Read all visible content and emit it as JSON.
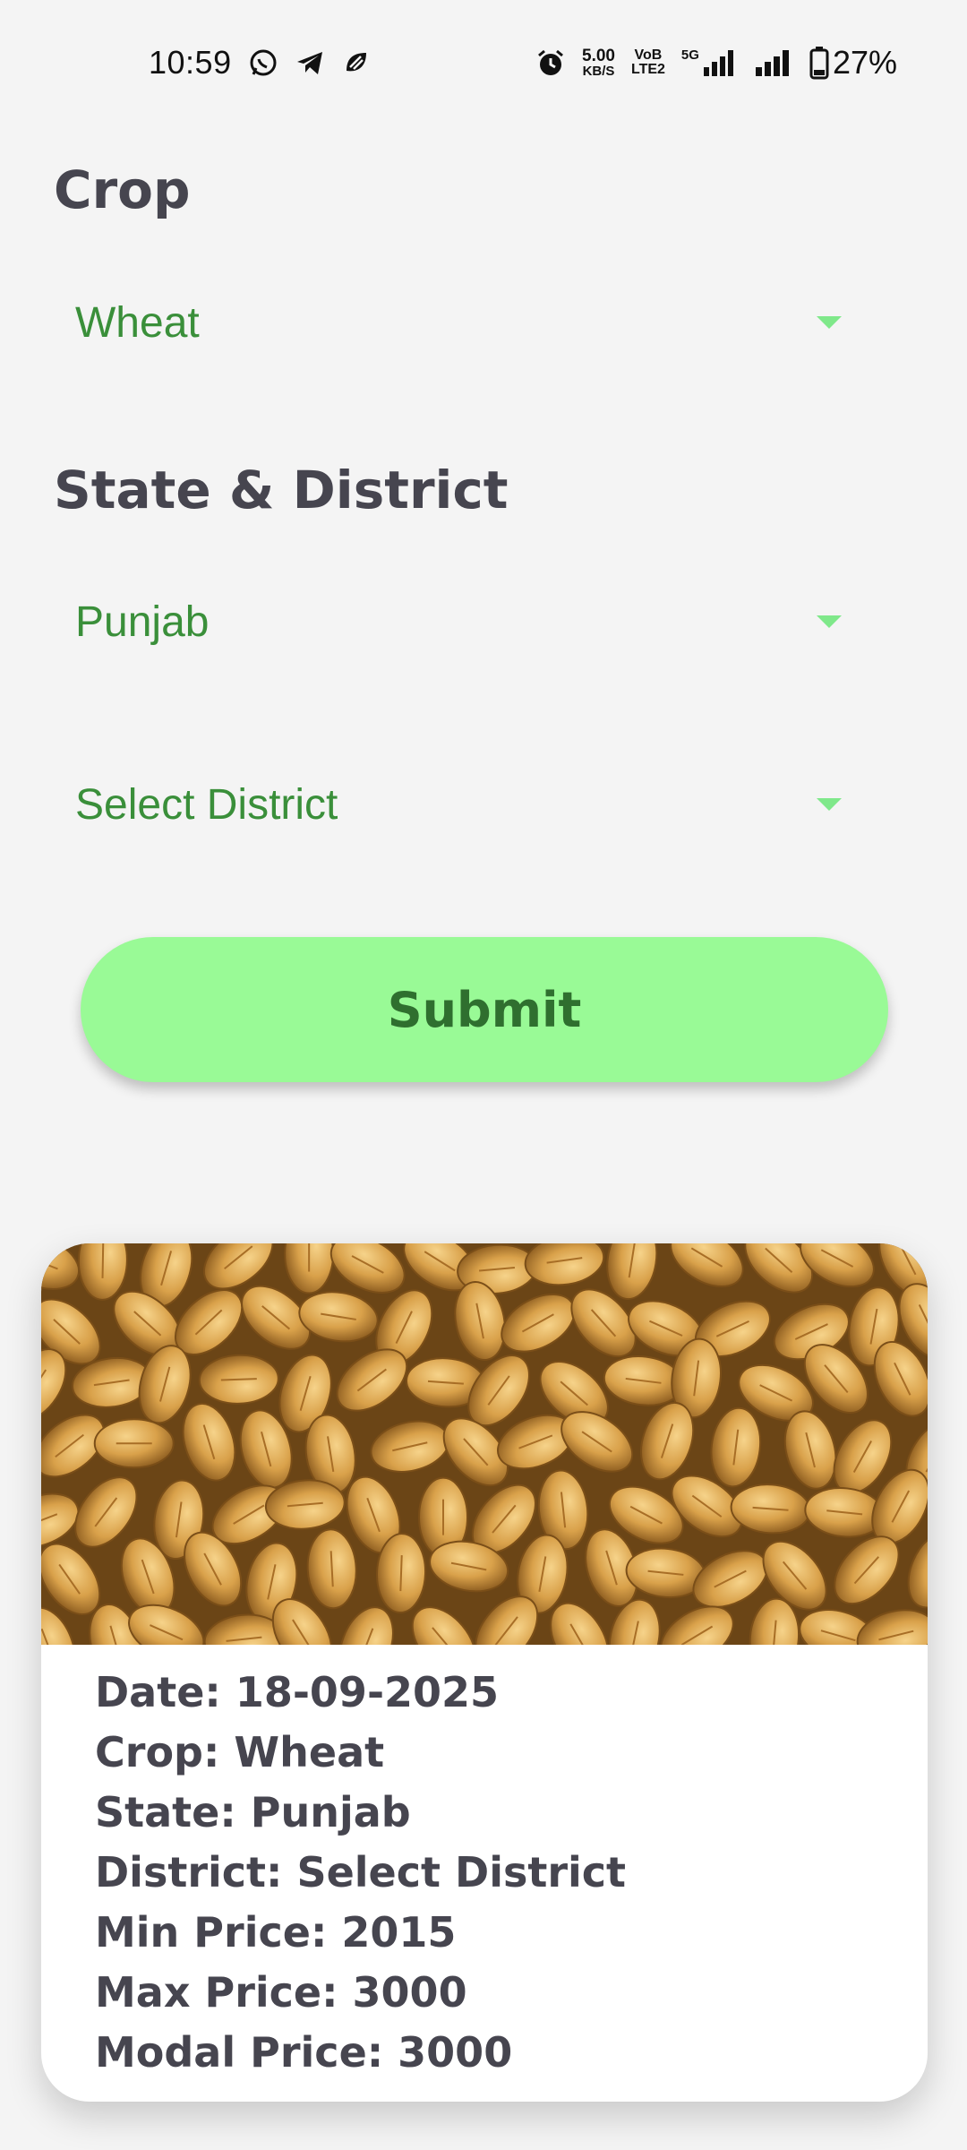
{
  "status_bar": {
    "time": "10:59",
    "speed_value": "5.00",
    "speed_unit": "KB/S",
    "volte_top": "VoB",
    "volte_bottom": "LTE2",
    "network": "5G",
    "battery": "27%",
    "icons": [
      "whatsapp-icon",
      "telegram-icon",
      "app-icon",
      "alarm-icon",
      "signal-icon",
      "signal-icon-2",
      "battery-icon"
    ]
  },
  "crop": {
    "title": "Crop",
    "selected": "Wheat"
  },
  "location": {
    "title": "State & District",
    "state_selected": "Punjab",
    "district_selected": "Select District"
  },
  "submit_label": "Submit",
  "result": {
    "image_alt": "wheat grains",
    "lines": [
      "Date: 18-09-2025",
      "Crop: Wheat",
      "State: Punjab",
      "District: Select District",
      "Min Price: 2015",
      "Max Price: 3000",
      "Modal Price: 3000"
    ]
  },
  "colors": {
    "accent_green_text": "#3a8f3a",
    "button_bg": "#99fa96",
    "caret": "#7fe88a",
    "heading": "#46454f"
  }
}
